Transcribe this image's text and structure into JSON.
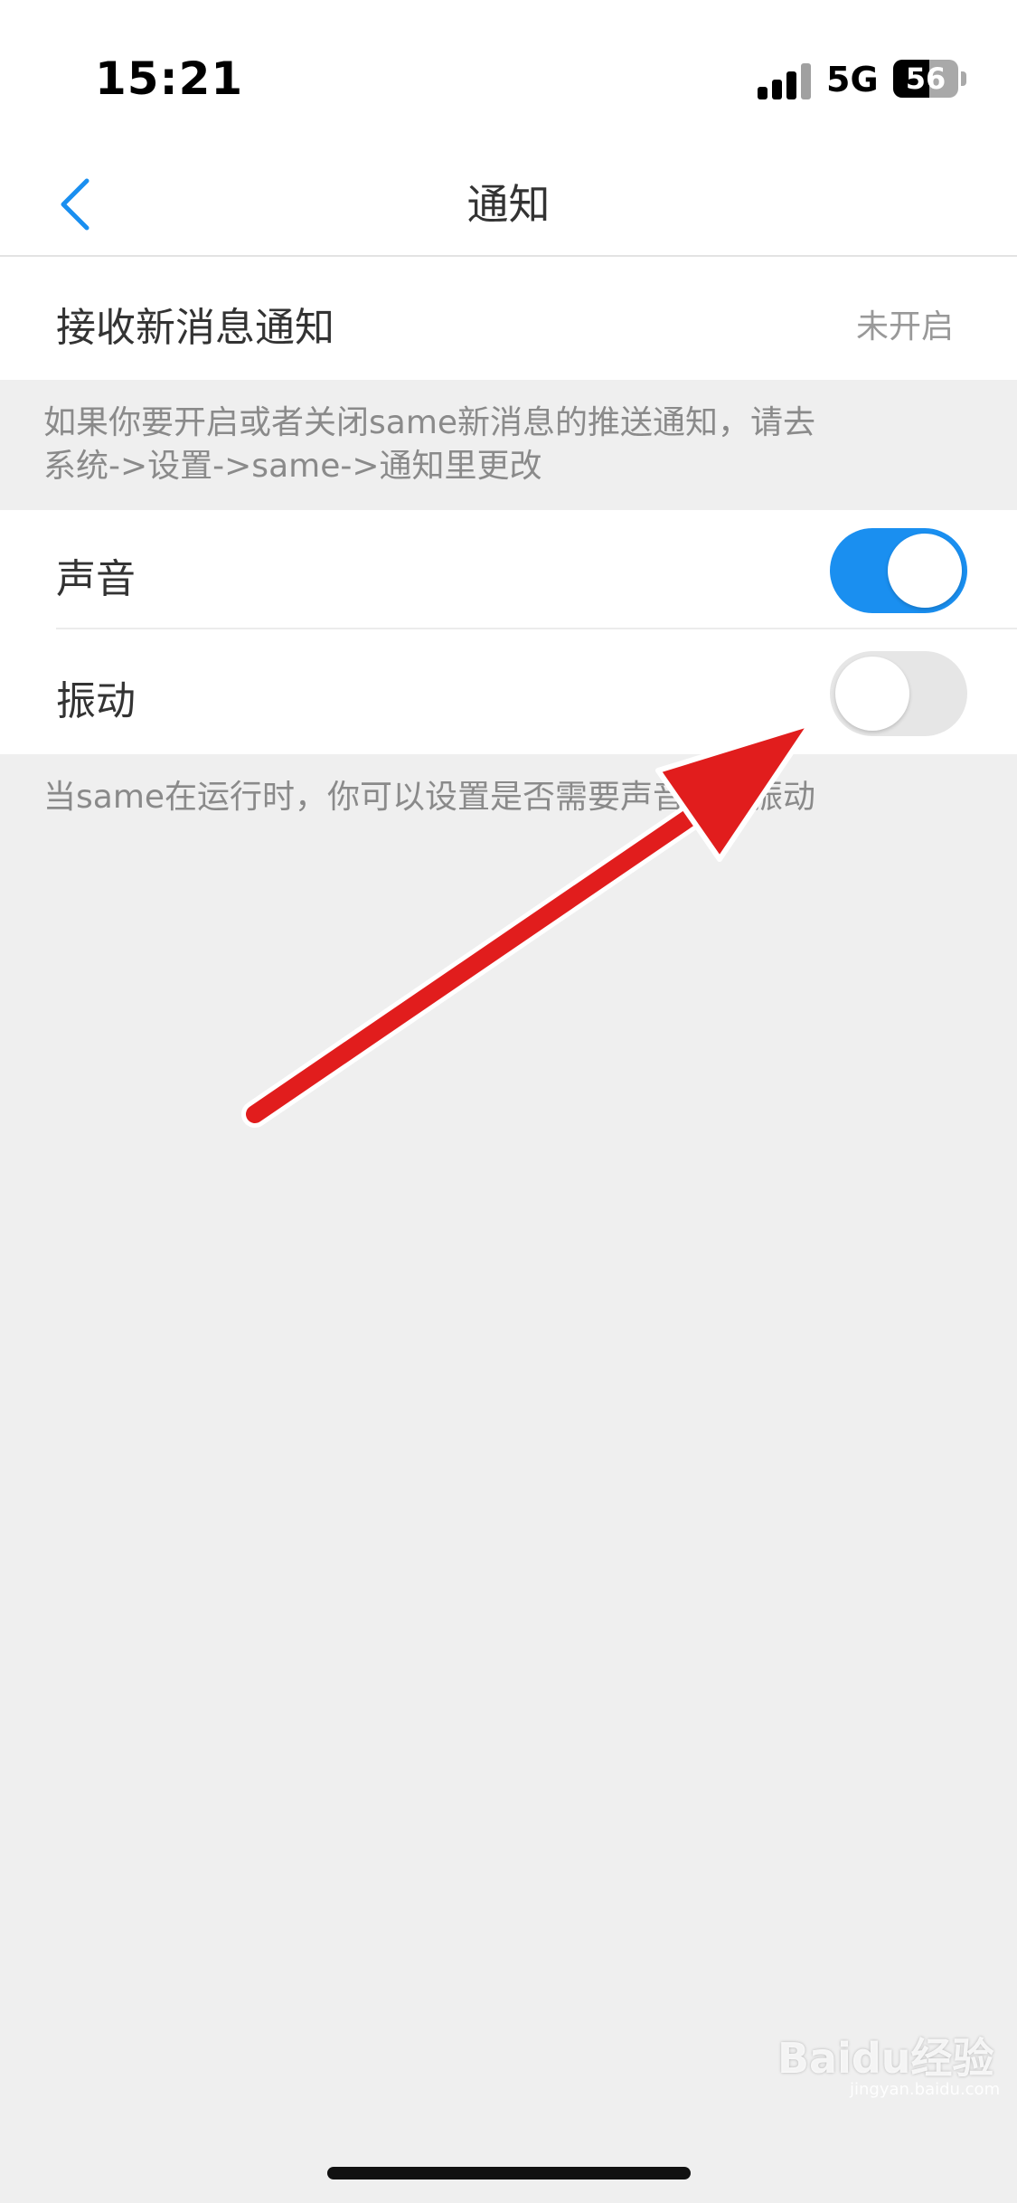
{
  "status_bar": {
    "time": "15:21",
    "network": "5G",
    "battery": "56",
    "battery_level": 0.56
  },
  "nav": {
    "title": "通知",
    "back_icon": "chevron-left-icon",
    "accent_color": "#1a8ff0"
  },
  "receive_notifications": {
    "label": "接收新消息通知",
    "value": "未开启"
  },
  "push_hint": {
    "line1": "如果你要开启或者关闭same新消息的推送通知，请去",
    "line2": "系统->设置->same->通知里更改"
  },
  "sound": {
    "label": "声音",
    "enabled": true
  },
  "vibration": {
    "label": "振动",
    "enabled": false
  },
  "runtime_hint": "当same在运行时，你可以设置是否需要声音或者振动",
  "watermark": {
    "text": "Baidu经验",
    "url": "jingyan.baidu.com"
  }
}
